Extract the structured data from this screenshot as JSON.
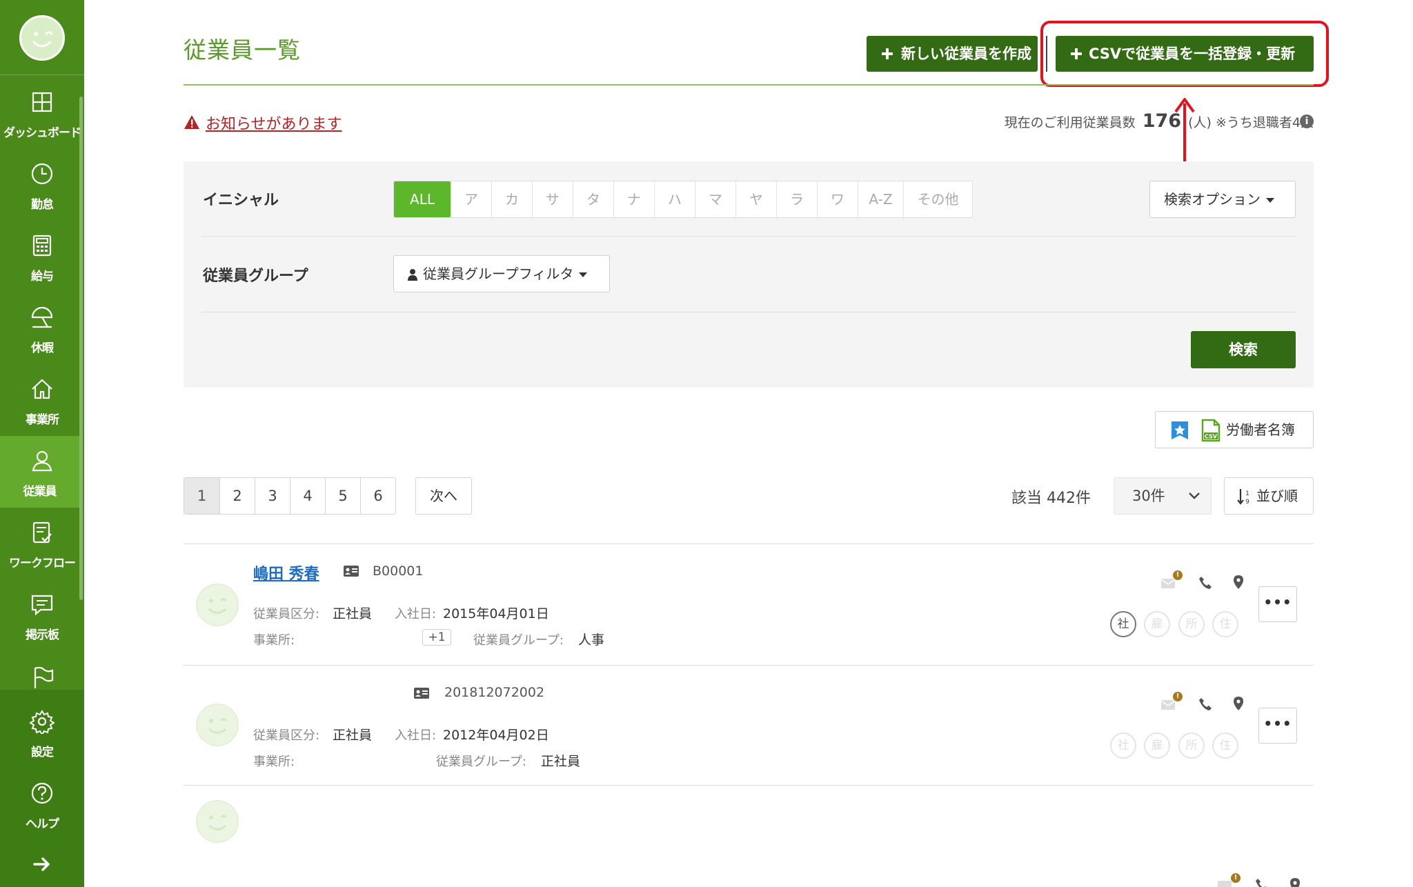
{
  "sidebar": {
    "items": [
      {
        "label": "ダッシュボード",
        "icon": "dashboard-icon"
      },
      {
        "label": "勤怠",
        "icon": "clock-icon"
      },
      {
        "label": "給与",
        "icon": "calculator-icon"
      },
      {
        "label": "休暇",
        "icon": "umbrella-icon"
      },
      {
        "label": "事業所",
        "icon": "home-icon"
      },
      {
        "label": "従業員",
        "icon": "person-icon",
        "active": true
      },
      {
        "label": "ワークフロー",
        "icon": "checklist-icon"
      },
      {
        "label": "掲示板",
        "icon": "chat-icon"
      },
      {
        "label": "",
        "icon": "flag-icon"
      },
      {
        "label": "設定",
        "icon": "gear-icon"
      },
      {
        "label": "ヘルプ",
        "icon": "help-icon"
      }
    ],
    "expand_icon": "arrow-right-icon"
  },
  "header": {
    "title": "従業員一覧",
    "new_button": "新しい従業員を作成",
    "csv_button": "CSVで従業員を一括登録・更新"
  },
  "notice": {
    "text": "お知らせがあります"
  },
  "usage": {
    "prefix": "現在のご利用従業員数",
    "count": "176",
    "unit": "(人)",
    "retired": "※うち退職者4人"
  },
  "filter": {
    "initial_label": "イニシャル",
    "initials": [
      "ALL",
      "ア",
      "カ",
      "サ",
      "タ",
      "ナ",
      "ハ",
      "マ",
      "ヤ",
      "ラ",
      "ワ",
      "A-Z",
      "その他"
    ],
    "search_options": "検索オプション",
    "group_label": "従業員グループ",
    "group_filter": "従業員グループフィルタ",
    "search_button": "検索"
  },
  "roster_button": "労働者名簿",
  "pagination": {
    "pages": [
      "1",
      "2",
      "3",
      "4",
      "5",
      "6"
    ],
    "next": "次へ",
    "hit_count": "該当 442件",
    "per_page": "30件",
    "sort": "並び順"
  },
  "employees": [
    {
      "name": "嶋田 秀春",
      "id": "B00001",
      "category_label": "従業員区分:",
      "category": "正社員",
      "hire_label": "入社日:",
      "hire_date": "2015年04月01日",
      "office_label": "事業所:",
      "office_extra": "+1",
      "group_label": "従業員グループ:",
      "group": "人事",
      "badges": [
        "社",
        "雇",
        "所",
        "住"
      ]
    },
    {
      "name": "",
      "id": "201812072002",
      "category_label": "従業員区分:",
      "category": "正社員",
      "hire_label": "入社日:",
      "hire_date": "2012年04月02日",
      "office_label": "事業所:",
      "group_label": "従業員グループ:",
      "group": "正社員",
      "badges": [
        "社",
        "雇",
        "所",
        "住"
      ]
    }
  ],
  "colors": {
    "sidebar": "#4a8a1a",
    "sidebar_active": "#64aa2c",
    "primary_button": "#336a14",
    "accent_green": "#5cb82a",
    "title_green": "#5a9a2a",
    "highlight_red": "#e8101c",
    "link_blue": "#1a6cc7",
    "notice_red": "#b42323"
  }
}
